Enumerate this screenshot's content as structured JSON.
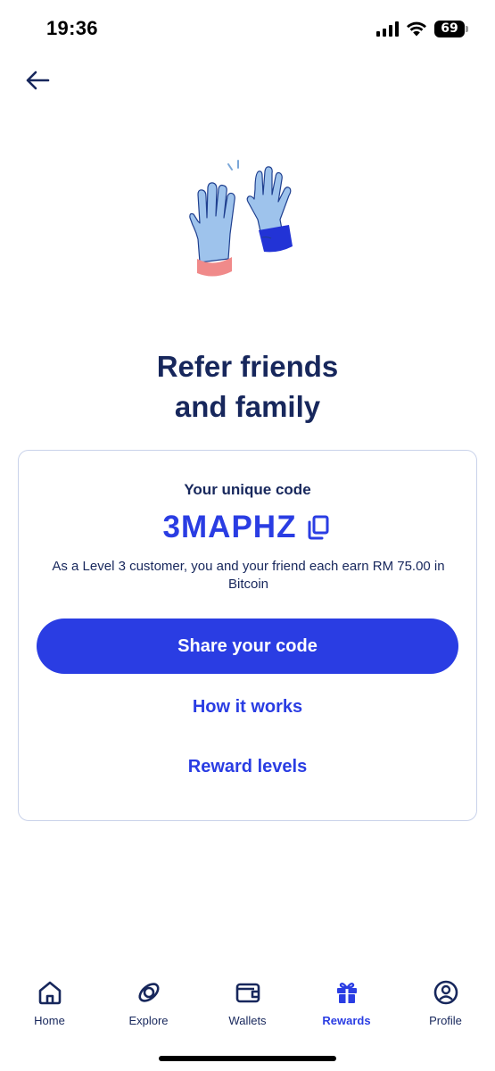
{
  "status_bar": {
    "time": "19:36",
    "battery": "69",
    "icons": [
      "signal-icon",
      "wifi-icon",
      "battery-icon"
    ]
  },
  "header": {
    "back_icon": "arrow-left-icon"
  },
  "illustration": {
    "name": "high-five-illustration",
    "colors": {
      "hand_fill": "#9ec3ec",
      "hand_stroke": "#1f3f8f",
      "left_cuff": "#f08a8a",
      "right_cuff": "#2233d6"
    }
  },
  "headline": {
    "line1": "Refer friends",
    "line2": "and family"
  },
  "code_card": {
    "label": "Your unique code",
    "code": "3MAPHZ",
    "copy_icon": "copy-icon",
    "description": "As a Level 3 customer, you and your friend each earn RM 75.00 in Bitcoin",
    "share_label": "Share your code",
    "how_it_works_label": "How it works",
    "reward_levels_label": "Reward levels"
  },
  "bottom_nav": {
    "items": [
      {
        "label": "Home",
        "icon": "home-icon",
        "active": false
      },
      {
        "label": "Explore",
        "icon": "explore-icon",
        "active": false
      },
      {
        "label": "Wallets",
        "icon": "wallet-icon",
        "active": false
      },
      {
        "label": "Rewards",
        "icon": "gift-icon",
        "active": true
      },
      {
        "label": "Profile",
        "icon": "profile-icon",
        "active": false
      }
    ]
  },
  "colors": {
    "primary": "#2a3de3",
    "text_dark": "#17275c",
    "card_border": "#c9d2ea",
    "background": "#ffffff"
  }
}
